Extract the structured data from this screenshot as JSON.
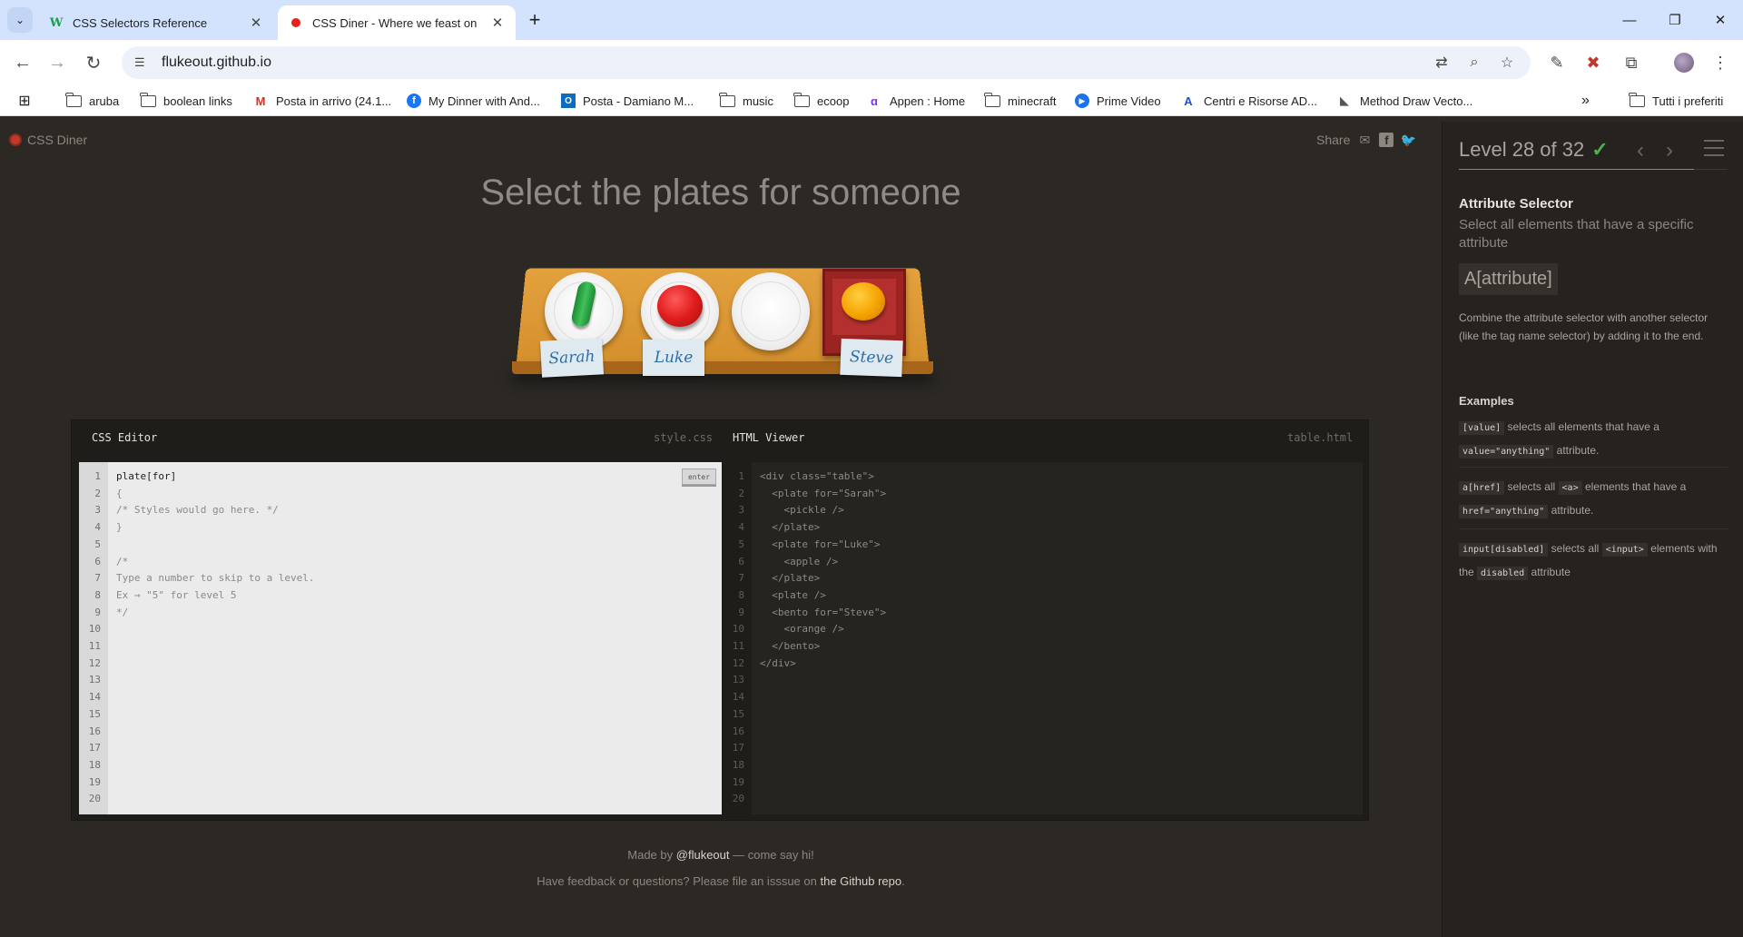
{
  "browser": {
    "tabs": [
      {
        "title": "CSS Selectors Reference",
        "favicon": "w3schools-icon",
        "close": "✕"
      },
      {
        "title": "CSS Diner - Where we feast on",
        "favicon": "cssdiner-icon",
        "close": "✕"
      }
    ],
    "url": "flukeout.github.io",
    "bookmarks": [
      {
        "label": "aruba",
        "icon": "folder-icon"
      },
      {
        "label": "boolean links",
        "icon": "folder-icon"
      },
      {
        "label": "Posta in arrivo (24.1...",
        "icon": "gmail-icon"
      },
      {
        "label": "My Dinner with And...",
        "icon": "facebook-icon"
      },
      {
        "label": "Posta - Damiano M...",
        "icon": "outlook-icon"
      },
      {
        "label": "music",
        "icon": "folder-icon"
      },
      {
        "label": "ecoop",
        "icon": "folder-icon"
      },
      {
        "label": "Appen : Home",
        "icon": "appen-icon"
      },
      {
        "label": "minecraft",
        "icon": "folder-icon"
      },
      {
        "label": "Prime Video",
        "icon": "primevideo-icon"
      },
      {
        "label": "Centri e Risorse AD...",
        "icon": "adobe-icon"
      },
      {
        "label": "Method Draw Vecto...",
        "icon": "methoddraw-icon"
      }
    ],
    "bookmarks_overflow": "»",
    "all_bookmarks": "Tutti i preferiti"
  },
  "diner": {
    "logo": "CSS Diner",
    "share": "Share",
    "order": "Select the plates for someone",
    "nametags": [
      "Sarah",
      "Luke",
      "Steve"
    ],
    "css_editor": {
      "title": "CSS Editor",
      "file": "style.css",
      "enter": "enter",
      "lines": [
        "plate[for]",
        "{",
        "/* Styles would go here. */",
        "}",
        "",
        "/*",
        "Type a number to skip to a level.",
        "Ex → \"5\" for level 5",
        "*/",
        "",
        "",
        "",
        "",
        "",
        "",
        "",
        "",
        "",
        "",
        ""
      ]
    },
    "html_viewer": {
      "title": "HTML Viewer",
      "file": "table.html",
      "lines": [
        "<div class=\"table\">",
        "  <plate for=\"Sarah\">",
        "    <pickle />",
        "  </plate>",
        "  <plate for=\"Luke\">",
        "    <apple />",
        "  </plate>",
        "  <plate />",
        "  <bento for=\"Steve\">",
        "    <orange />",
        "  </bento>",
        "</div>",
        "",
        "",
        "",
        "",
        "",
        "",
        "",
        ""
      ]
    },
    "footer": {
      "made_by_prefix": "Made by",
      "made_by_link": "@flukeout",
      "made_by_suffix": "— come say hi!",
      "feedback_prefix": "Have feedback or questions? Please file an isssue on",
      "feedback_link": "the Github repo",
      "feedback_suffix": "."
    }
  },
  "sidebar": {
    "level": "Level 28 of 32",
    "progress": 0.875,
    "selector_name": "Attribute Selector",
    "selector_title": "Select all elements that have a specific attribute",
    "syntax": "A[attribute]",
    "hint": "Combine the attribute selector with another selector (like the tag name selector) by adding it to the end.",
    "examples_title": "Examples",
    "examples": [
      {
        "code1": "[value]",
        "text1": "selects all elements that have a",
        "code2": "value=\"anything\"",
        "text2": "attribute."
      },
      {
        "code1": "a[href]",
        "text1": "selects all",
        "code2": "<a>",
        "text2": "elements that have a",
        "code3": "href=\"anything\"",
        "text3": "attribute."
      },
      {
        "code1": "input[disabled]",
        "text1": "selects all",
        "code2": "<input>",
        "text2": "elements with the",
        "code3": "disabled",
        "text3": "attribute"
      }
    ]
  },
  "colors": {
    "accent_check": "#4cb04c",
    "page_bg": "#2c2925"
  }
}
